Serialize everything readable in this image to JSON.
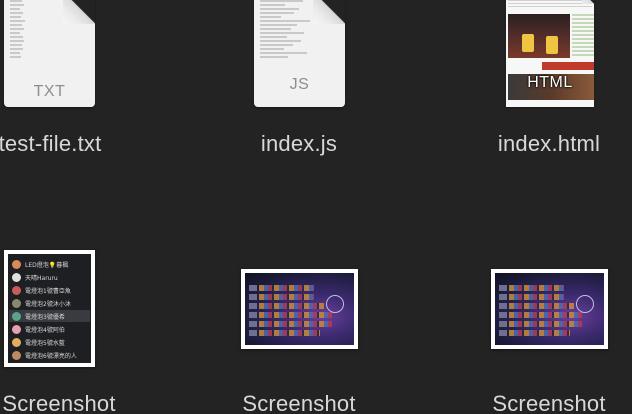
{
  "files": [
    {
      "name": "test-file.txt",
      "kind": "text",
      "ext_label": "TXT",
      "icon": "txt-document-icon"
    },
    {
      "name": "index.js",
      "kind": "text",
      "ext_label": "JS",
      "icon": "js-document-icon"
    },
    {
      "name": "index.html",
      "kind": "html",
      "ext_label": "HTML",
      "icon": "html-document-icon"
    },
    {
      "name": "Screenshot",
      "kind": "screenshot",
      "icon": "screenshot-chat-thumbnail-icon"
    },
    {
      "name": "Screenshot",
      "kind": "screenshot",
      "icon": "screenshot-game-thumbnail-icon"
    },
    {
      "name": "Screenshot",
      "kind": "screenshot",
      "icon": "screenshot-game-thumbnail-icon"
    }
  ],
  "chat_list": [
    {
      "label": "LED燈泡💡暮楓",
      "color": "#d98a5a"
    },
    {
      "label": "天晴Haruru",
      "color": "#e0e0e0"
    },
    {
      "label": "電燈泡1號曹亞魚",
      "color": "#c75c5c"
    },
    {
      "label": "電燈泡2號沐小沐",
      "color": "#8a8a6a"
    },
    {
      "label": "電燈泡3號優希",
      "color": "#5aa58a"
    },
    {
      "label": "電燈泡4號阿伯",
      "color": "#e6a0b0"
    },
    {
      "label": "電燈泡5號水藍",
      "color": "#e0b060"
    },
    {
      "label": "電燈泡6號漂亮的人",
      "color": "#c08a60"
    }
  ],
  "selected_chat_index": 4,
  "colors": {
    "background": "#232323",
    "label_text": "#d8d8d8",
    "document": "#f1f1f1"
  }
}
